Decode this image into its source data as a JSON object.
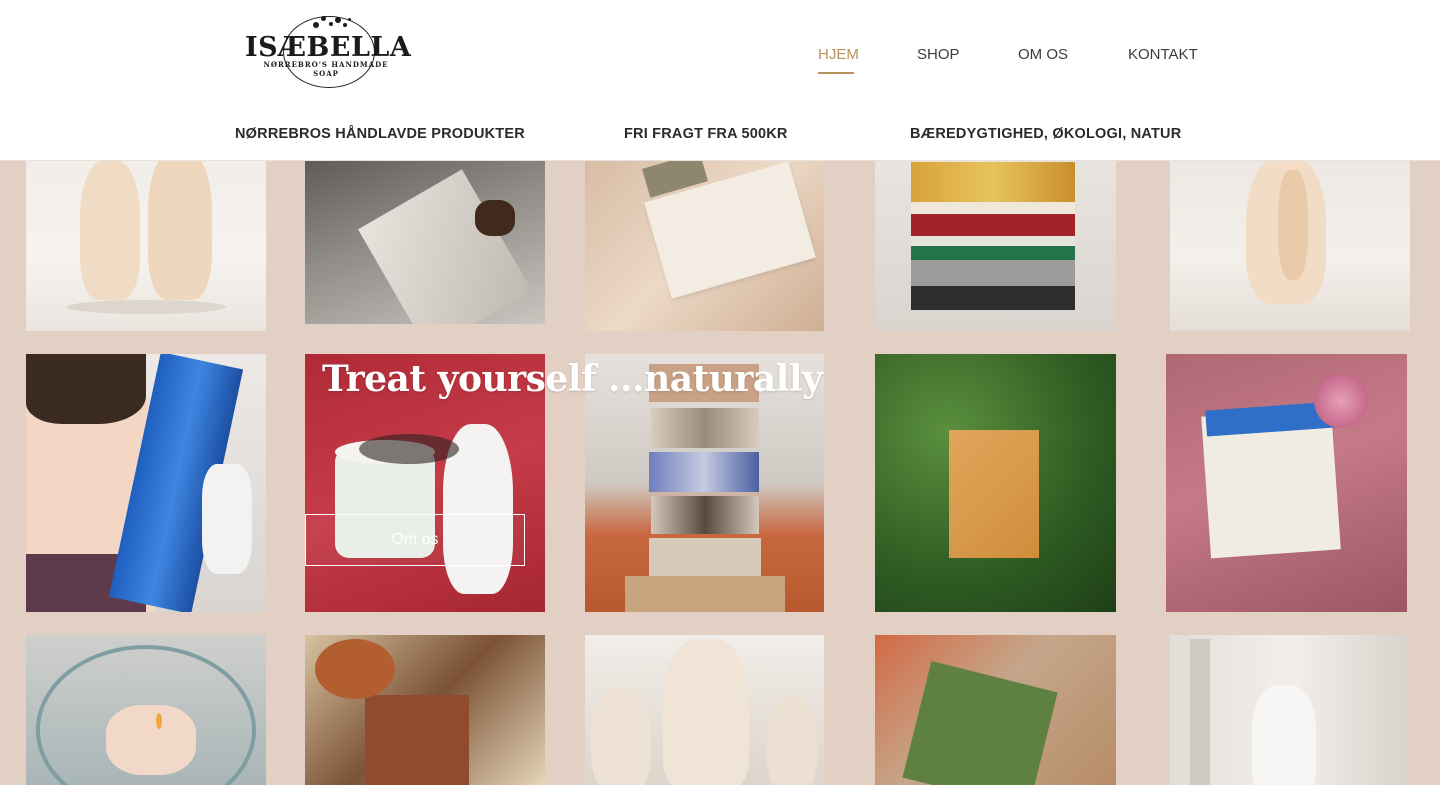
{
  "brand": {
    "logo_text": "ISÆBELLA",
    "logo_subtitle": "NØRREBRO'S HANDMADE SOAP"
  },
  "nav": {
    "items": [
      {
        "label": "HJEM",
        "active": true
      },
      {
        "label": "SHOP",
        "active": false
      },
      {
        "label": "OM OS",
        "active": false
      },
      {
        "label": "KONTAKT",
        "active": false
      }
    ]
  },
  "usp_bar": {
    "items": [
      "NØRREBROS HÅNDLAVDE PRODUKTER",
      "FRI FRAGT FRA 500KR",
      "BÆREDYGTIGHED, ØKOLOGI, NATUR"
    ]
  },
  "hero": {
    "title": "Treat yourself ...naturally",
    "button_label": "Om os"
  },
  "colors": {
    "accent": "#b8925b",
    "page_background": "#e3d0c4",
    "header_background": "#ffffff"
  },
  "gallery": {
    "tiles": [
      {
        "name": "body-candles-photo"
      },
      {
        "name": "coffee-soap-photo"
      },
      {
        "name": "soap-box-on-silk-photo"
      },
      {
        "name": "stacked-soaps-photo"
      },
      {
        "name": "embrace-candle-photo"
      },
      {
        "name": "woman-with-blue-soap-photo"
      },
      {
        "name": "cream-and-candle-photo"
      },
      {
        "name": "soap-stack-photo"
      },
      {
        "name": "soap-on-plants-photo"
      },
      {
        "name": "lavender-fields-soap-photo"
      },
      {
        "name": "floating-candle-photo"
      },
      {
        "name": "dried-flowers-soap-photo"
      },
      {
        "name": "david-head-candle-photo"
      },
      {
        "name": "green-soap-photo"
      },
      {
        "name": "torso-candle-photo"
      }
    ]
  }
}
